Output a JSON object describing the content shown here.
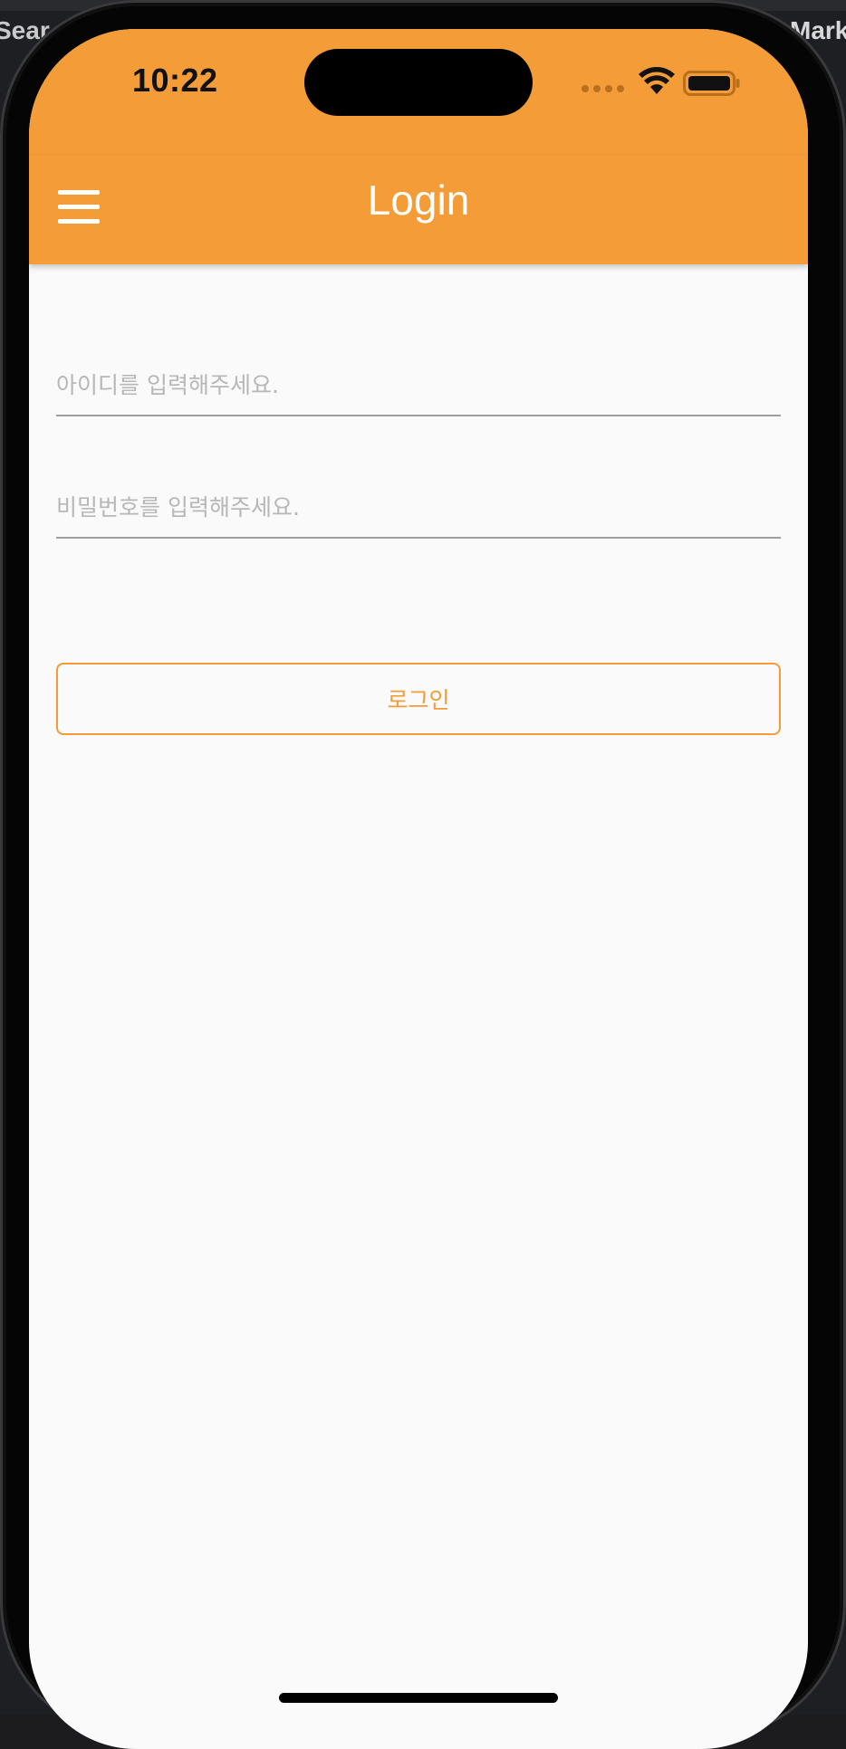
{
  "background": {
    "left_text": "Sear",
    "right_text": "Marke"
  },
  "status_bar": {
    "time": "10:22",
    "color": "#f39c38"
  },
  "app_bar": {
    "title": "Login",
    "menu_icon": "hamburger-menu-icon",
    "color": "#f39c38"
  },
  "form": {
    "id_placeholder": "아이디를 입력해주세요.",
    "id_value": "",
    "password_placeholder": "비밀번호를 입력해주세요.",
    "password_value": "",
    "login_label": "로그인",
    "accent": "#f39c38"
  }
}
